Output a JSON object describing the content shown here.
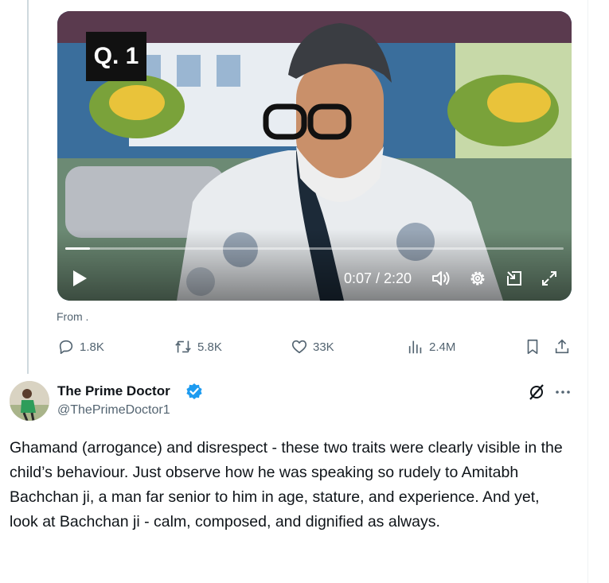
{
  "video": {
    "badge": "Q. 1",
    "timecode": "0:07 / 2:20",
    "progress": 0.05
  },
  "from_label": "From .",
  "actions": {
    "replies": "1.8K",
    "reposts": "5.8K",
    "likes": "33K",
    "views": "2.4M"
  },
  "post": {
    "display_name": "The Prime Doctor",
    "handle": "@ThePrimeDoctor1",
    "text": "Ghamand (arrogance) and disrespect - these two traits were clearly visible in the child’s behaviour. Just observe how he was speaking so rudely to Amitabh Bachchan ji, a man far senior to him in age, stature, and experience. And yet, look at Bachchan ji - calm, composed, and dignified as always."
  },
  "colors": {
    "secondary_text": "#536471",
    "verified_blue": "#1d9bf0",
    "thread_line": "#cfd9de"
  },
  "icons": [
    "reply-icon",
    "repost-icon",
    "like-icon",
    "views-icon",
    "bookmark-icon",
    "share-icon",
    "verified-icon",
    "grok-icon",
    "more-icon",
    "play-icon",
    "volume-icon",
    "settings-icon",
    "pip-icon",
    "fullscreen-icon"
  ]
}
